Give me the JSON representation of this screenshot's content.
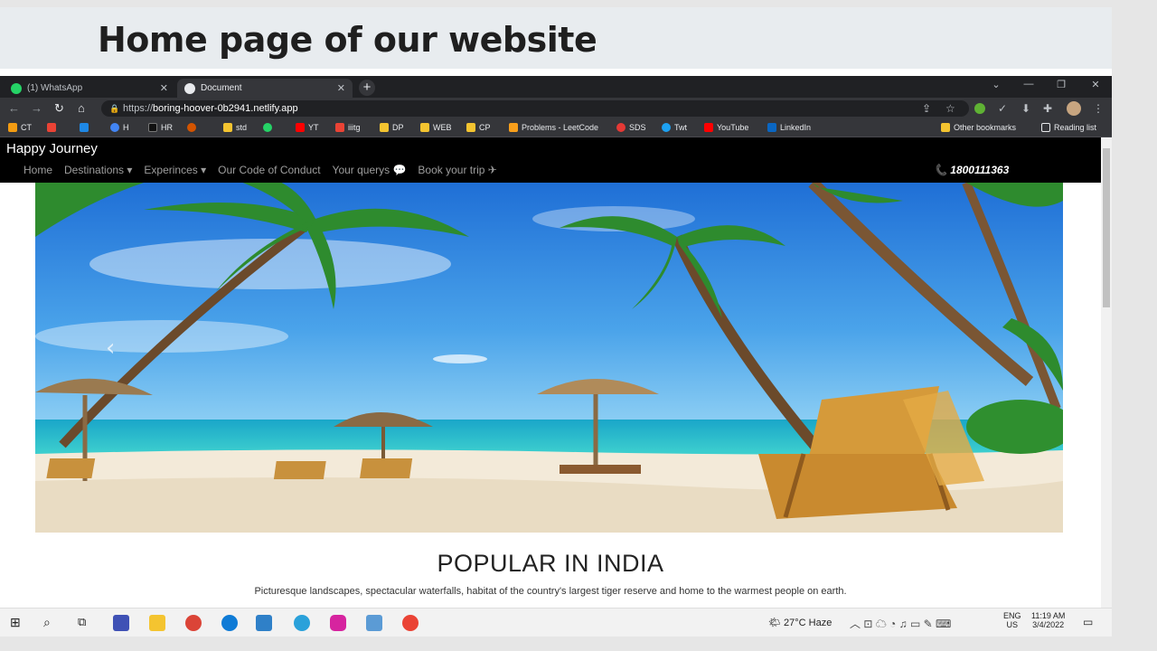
{
  "slide": {
    "title": "Home page of our website"
  },
  "browser": {
    "tabs": [
      {
        "label": "(1) WhatsApp",
        "icon": "whatsapp-icon"
      },
      {
        "label": "Document",
        "icon": "globe-icon"
      }
    ],
    "url_prefix": "https://",
    "url_host": "boring-hoover-0b2941.netlify.app",
    "bookmarks": [
      "CT",
      "H",
      "HR",
      "std",
      "YT",
      "iiitg",
      "DP",
      "WEB",
      "CP",
      "Problems - LeetCode",
      "SDS",
      "Twt",
      "YouTube",
      "LinkedIn"
    ],
    "other_bookmarks": "Other bookmarks",
    "reading_list": "Reading list"
  },
  "site": {
    "brand": "Happy Journey",
    "nav": [
      "Home",
      "Destinations ▾",
      "Experinces ▾",
      "Our Code of Conduct",
      "Your querys 💬",
      "Book your trip ✈"
    ],
    "phone": "1800111363",
    "section_title": "POPULAR IN INDIA",
    "section_desc": "Picturesque landscapes, spectacular waterfalls, habitat of the country's largest tiger reserve and home to the warmest people on earth."
  },
  "taskbar": {
    "weather": "27°C  Haze",
    "lang": "ENG",
    "region": "US",
    "time": "11:19 AM",
    "date": "3/4/2022"
  },
  "colors": {
    "accent": "#3d6fb3",
    "page_bg": "#ffffff",
    "navbar": "#000000"
  }
}
